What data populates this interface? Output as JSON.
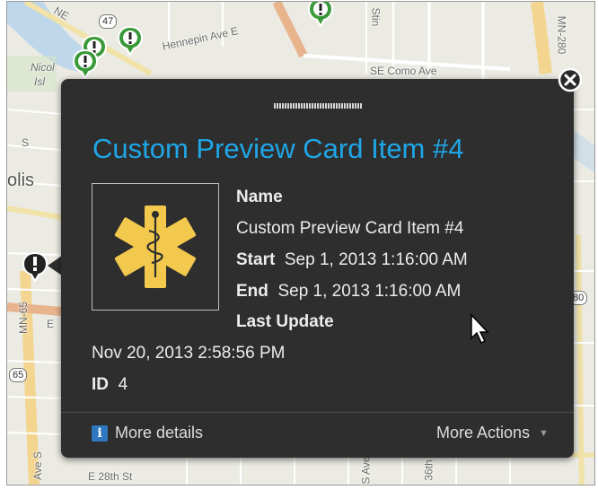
{
  "map": {
    "labels": {
      "ne": "NE",
      "hennepin": "Hennepin Ave E",
      "nicollet": "Nicol",
      "island": "Isl",
      "como": "SE Como Ave",
      "minneapolis": "olis",
      "mn280": "MN-280",
      "mn65": "MN-65",
      "ave_s": "Ave S",
      "e28th": "E 28th St",
      "ave_s2": "S Ave",
      "sixth": "36th",
      "s_letter": "S",
      "stin": "Stin",
      "e_letter": "E"
    },
    "shields": {
      "r47": "47",
      "r65": "65",
      "r80": "80"
    }
  },
  "popup": {
    "title": "Custom Preview Card Item #4",
    "name_label": "Name",
    "name_value": "Custom Preview Card Item #4",
    "start_label": "Start",
    "start_value": "Sep 1, 2013 1:16:00 AM",
    "end_label": "End",
    "end_value": "Sep 1, 2013 1:16:00 AM",
    "last_update_label": "Last Update",
    "last_update_value": "Nov 20, 2013 2:58:56 PM",
    "id_label": "ID",
    "id_value": "4",
    "more_details": "More details",
    "more_actions": "More Actions",
    "info_glyph": "i",
    "icon": "star-of-life-icon",
    "close_icon": "close-icon"
  },
  "colors": {
    "title": "#1fa6e6",
    "popup_bg": "#2e2e2e",
    "pin_green": "#3a9a3a",
    "emblem_yellow": "#f2c94c"
  }
}
